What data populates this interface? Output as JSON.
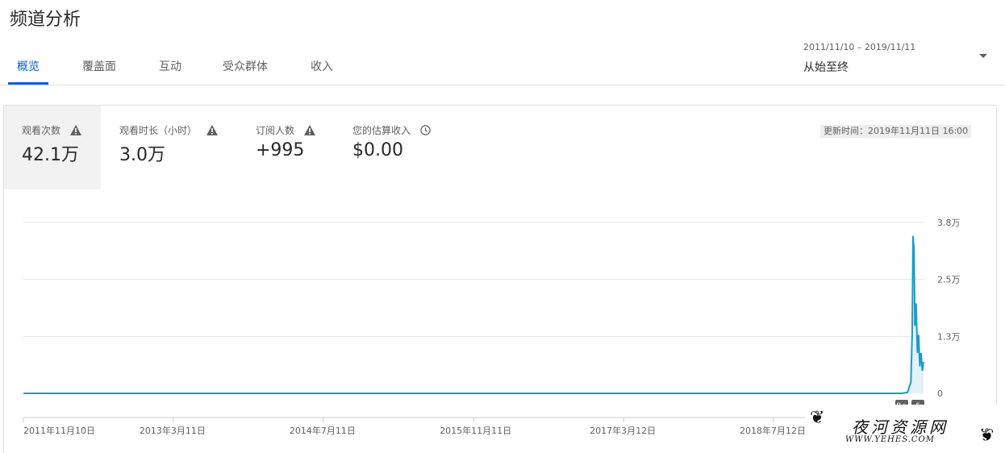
{
  "page": {
    "title": "频道分析"
  },
  "tabs": [
    {
      "label": "概览",
      "active": true
    },
    {
      "label": "覆盖面",
      "active": false
    },
    {
      "label": "互动",
      "active": false
    },
    {
      "label": "受众群体",
      "active": false
    },
    {
      "label": "收入",
      "active": false
    }
  ],
  "date_range": {
    "dates": "2011/11/10 – 2019/11/11",
    "label": "从始至终"
  },
  "metrics": [
    {
      "label": "观看次数",
      "value": "42.1万",
      "icon": "warning-icon"
    },
    {
      "label": "观看时长（小时）",
      "value": "3.0万",
      "icon": "warning-icon"
    },
    {
      "label": "订阅人数",
      "value": "+995",
      "icon": "warning-icon"
    },
    {
      "label": "您的估算收入",
      "value": "$0.00",
      "icon": "clock-icon"
    }
  ],
  "update_time": "更新时间：2019年11月11日 16:00",
  "markers": [
    "9+",
    "6"
  ],
  "watermark": {
    "text": "夜河资源网",
    "url": "WWW.YEHES.COM"
  },
  "colors": {
    "accent": "#065fd4",
    "line": "#1c9cc4",
    "area": "#e3f2f9"
  },
  "chart_data": {
    "type": "line",
    "y_ticks": [
      "0",
      "1.3万",
      "2.5万",
      "3.8万"
    ],
    "ylim": [
      0,
      38000
    ],
    "x_ticks": [
      "2011年11月10日",
      "2013年3月11日",
      "2014年7月11日",
      "2015年11月11日",
      "2017年3月12日",
      "2018年7月12日"
    ],
    "x": [
      "2011-11-10",
      "2019-09-01",
      "2019-09-20",
      "2019-10-01",
      "2019-10-05",
      "2019-10-08",
      "2019-10-11",
      "2019-10-14",
      "2019-10-18",
      "2019-10-22",
      "2019-10-26",
      "2019-10-30",
      "2019-11-03",
      "2019-11-07",
      "2019-11-11"
    ],
    "series": [
      {
        "values": [
          0,
          0,
          200,
          2500,
          13000,
          35000,
          32000,
          15000,
          20000,
          9000,
          13000,
          6000,
          9000,
          5000,
          7000
        ]
      }
    ],
    "grid": true
  }
}
